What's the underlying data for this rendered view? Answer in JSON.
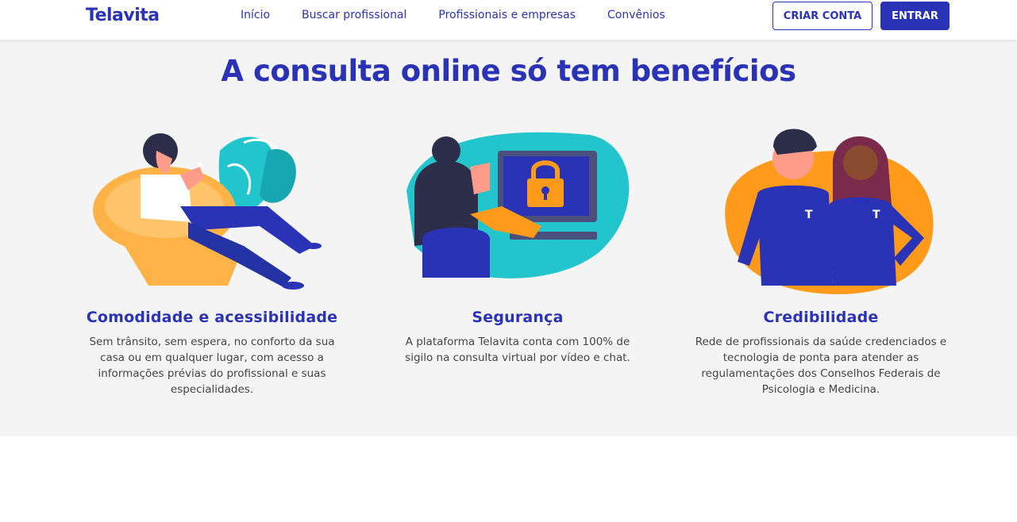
{
  "header": {
    "logo_text": "Telavita",
    "nav": [
      {
        "label": "Início"
      },
      {
        "label": "Buscar profissional"
      },
      {
        "label": "Profissionais e empresas"
      },
      {
        "label": "Convênios"
      }
    ],
    "create_account_label": "CRIAR CONTA",
    "login_label": "ENTRAR"
  },
  "benefits": {
    "heading_regular": "A consulta online ",
    "heading_bold": "só tem benefícios",
    "items": [
      {
        "title": "Comodidade e acessibilidade",
        "text": "Sem trânsito, sem espera, no conforto da sua casa ou em qualquer lugar, com acesso a informações prévias do profissional e suas especialidades.",
        "illustration": "woman-in-chair-with-phone-illustration"
      },
      {
        "title": "Segurança",
        "text": "A plataforma Telavita conta com 100% de sigilo na consulta virtual por vídeo e chat.",
        "illustration": "woman-at-computer-with-lock-illustration"
      },
      {
        "title": "Credibilidade",
        "text": "Rede de profissionais da saúde credenciados e tecnologia de ponta para atender as regulamentações dos Conselhos Federais de Psicologia e Medicina.",
        "illustration": "two-professionals-illustration"
      }
    ]
  },
  "colors": {
    "brand": "#2a33b5",
    "orange": "#ff9a1a",
    "teal": "#22c5cc",
    "section_bg": "#f4f4f4"
  }
}
